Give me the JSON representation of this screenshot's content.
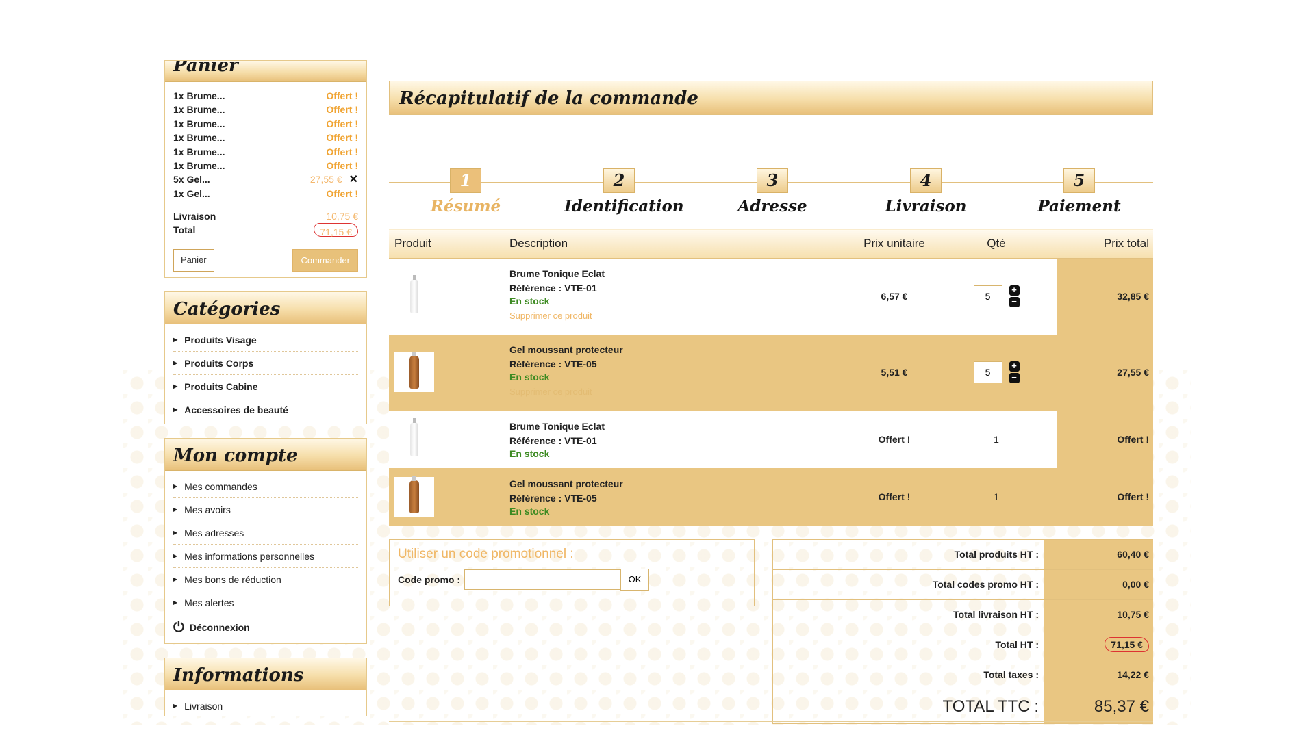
{
  "sidebar": {
    "cart": {
      "title": "Panier",
      "lines": [
        {
          "label": "1x Brume...",
          "price": "Offert !",
          "removable": false
        },
        {
          "label": "1x Brume...",
          "price": "Offert !",
          "removable": false
        },
        {
          "label": "1x Brume...",
          "price": "Offert !",
          "removable": false
        },
        {
          "label": "1x Brume...",
          "price": "Offert !",
          "removable": false
        },
        {
          "label": "1x Brume...",
          "price": "Offert !",
          "removable": false
        },
        {
          "label": "1x Brume...",
          "price": "Offert !",
          "removable": false
        },
        {
          "label": "5x Gel...",
          "price": "27,55 €",
          "removable": true
        },
        {
          "label": "1x Gel...",
          "price": "Offert !",
          "removable": false
        }
      ],
      "remove_glyph": "✕",
      "shipping_label": "Livraison",
      "shipping_value": "10,75 €",
      "total_label": "Total",
      "total_value": "71,15 €",
      "cart_button": "Panier",
      "order_button": "Commander"
    },
    "categories": {
      "title": "Catégories",
      "items": [
        "Produits Visage",
        "Produits Corps",
        "Produits Cabine",
        "Accessoires de beauté"
      ]
    },
    "account": {
      "title": "Mon compte",
      "items": [
        "Mes commandes",
        "Mes avoirs",
        "Mes adresses",
        "Mes informations personnelles",
        "Mes bons de réduction",
        "Mes alertes"
      ],
      "logout": "Déconnexion"
    },
    "info": {
      "title": "Informations",
      "items": [
        "Livraison"
      ]
    }
  },
  "main": {
    "title": "Récapitulatif de la commande",
    "steps": [
      {
        "num": "1",
        "label": "Résumé"
      },
      {
        "num": "2",
        "label": "Identification"
      },
      {
        "num": "3",
        "label": "Adresse"
      },
      {
        "num": "4",
        "label": "Livraison"
      },
      {
        "num": "5",
        "label": "Paiement"
      }
    ],
    "columns": [
      "Produit",
      "Description",
      "Prix unitaire",
      "Qté",
      "Prix total"
    ],
    "rows": [
      {
        "name": "Brume Tonique Eclat",
        "ref": "Référence : VTE-01",
        "stock": "En stock",
        "delete": "Supprimer ce produit",
        "unit": "6,57 €",
        "qty": "5",
        "total": "32,85 €",
        "bottle": "white"
      },
      {
        "name": "Gel moussant protecteur",
        "ref": "Référence : VTE-05",
        "stock": "En stock",
        "delete": "Supprimer ce produit",
        "unit": "5,51 €",
        "qty": "5",
        "total": "27,55 €",
        "bottle": "orange"
      },
      {
        "name": "Brume Tonique Eclat",
        "ref": "Référence : VTE-01",
        "stock": "En stock",
        "unit": "Offert !",
        "qty": "1",
        "total": "Offert !",
        "bottle": "white"
      },
      {
        "name": "Gel moussant protecteur",
        "ref": "Référence : VTE-05",
        "stock": "En stock",
        "unit": "Offert !",
        "qty": "1",
        "total": "Offert !",
        "bottle": "orange"
      }
    ],
    "promo": {
      "title": "Utiliser un code promotionnel :",
      "label": "Code promo :",
      "value": "",
      "button": "OK"
    },
    "totals": [
      {
        "label": "Total produits HT :",
        "value": "60,40 €"
      },
      {
        "label": "Total codes promo HT :",
        "value": "0,00 €"
      },
      {
        "label": "Total livraison HT :",
        "value": "10,75 €"
      },
      {
        "label": "Total HT :",
        "value": "71,15 €"
      },
      {
        "label": "Total taxes :",
        "value": "14,22 €"
      },
      {
        "label": "TOTAL TTC :",
        "value": "85,37 €"
      }
    ]
  },
  "colors": {
    "gold": "#e9c682",
    "accent_orange": "#f0a433",
    "stock_green": "#3c8a21",
    "annotation_red": "#dd3333"
  }
}
